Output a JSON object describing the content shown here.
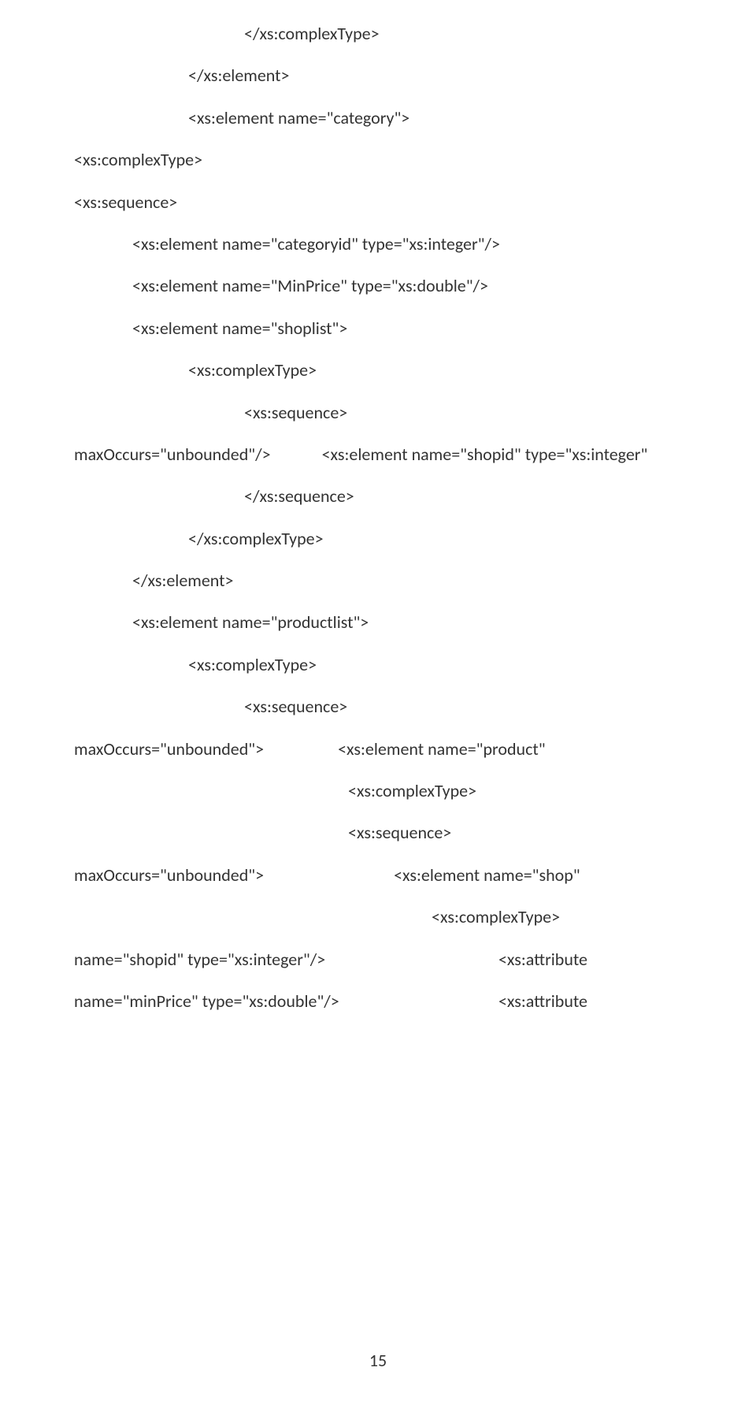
{
  "lines": {
    "l1": "</xs:complexType>",
    "l2": "</xs:element>",
    "l3": "<xs:element name=\"category\">",
    "l4": "<xs:complexType>",
    "l5": "<xs:sequence>",
    "l6": "<xs:element name=\"categoryid\" type=\"xs:integer\"/>",
    "l7": "<xs:element name=\"MinPrice\" type=\"xs:double\"/>",
    "l8": "<xs:element name=\"shoplist\">",
    "l9": "<xs:complexType>",
    "l10": "<xs:sequence>",
    "l11a": "maxOccurs=\"unbounded\"/>",
    "l11b": "<xs:element name=\"shopid\" type=\"xs:integer\"",
    "l12": "</xs:sequence>",
    "l13": "</xs:complexType>",
    "l14": "</xs:element>",
    "l15": "<xs:element name=\"productlist\">",
    "l16": "<xs:complexType>",
    "l17": "<xs:sequence>",
    "l18a": "maxOccurs=\"unbounded\">",
    "l18b": "<xs:element name=\"product\"",
    "l19": "<xs:complexType>",
    "l20": "<xs:sequence>",
    "l21a": "maxOccurs=\"unbounded\">",
    "l21b": "<xs:element name=\"shop\"",
    "l22": "<xs:complexType>",
    "l23a": "name=\"shopid\" type=\"xs:integer\"/>",
    "l23b": "<xs:attribute",
    "l24a": "name=\"minPrice\" type=\"xs:double\"/>",
    "l24b": "<xs:attribute"
  },
  "pageNumber": "15"
}
